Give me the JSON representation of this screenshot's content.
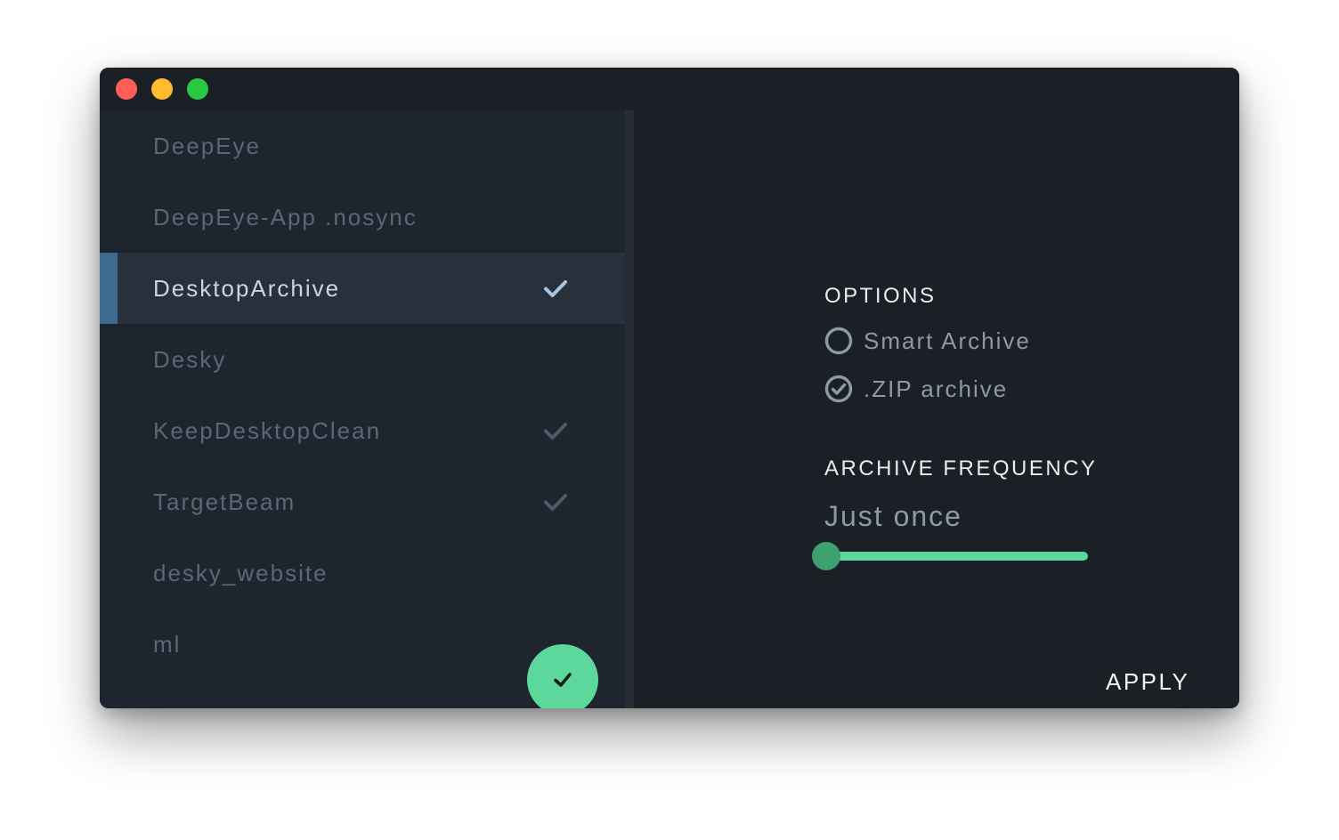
{
  "colors": {
    "close": "#ff5f57",
    "minimize": "#febc2e",
    "maximize": "#28c840",
    "accent_green": "#5dd89c",
    "selection_bar": "#3e6a8f",
    "check_selected": "#a9c7df",
    "check_normal": "#4d5966"
  },
  "sidebar": {
    "items": [
      {
        "label": "DeepEye",
        "checked": false,
        "selected": false
      },
      {
        "label": "DeepEye-App .nosync",
        "checked": false,
        "selected": false
      },
      {
        "label": "DesktopArchive",
        "checked": true,
        "selected": true
      },
      {
        "label": "Desky",
        "checked": false,
        "selected": false
      },
      {
        "label": "KeepDesktopClean",
        "checked": true,
        "selected": false
      },
      {
        "label": "TargetBeam",
        "checked": true,
        "selected": false
      },
      {
        "label": "desky_website",
        "checked": false,
        "selected": false
      },
      {
        "label": "ml",
        "checked": false,
        "selected": false
      }
    ],
    "fab_icon": "check-icon"
  },
  "options": {
    "heading": "OPTIONS",
    "choices": [
      {
        "label": "Smart Archive",
        "checked": false
      },
      {
        "label": ".ZIP archive",
        "checked": true
      }
    ]
  },
  "frequency": {
    "heading": "ARCHIVE FREQUENCY",
    "value_label": "Just once",
    "slider_level": 0
  },
  "apply_label": "APPLY"
}
